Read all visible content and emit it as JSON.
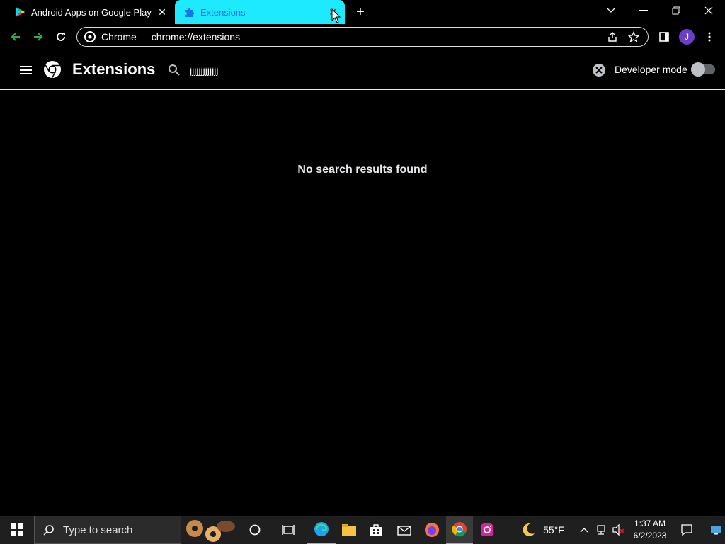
{
  "tabs": [
    {
      "title": "Android Apps on Google Play",
      "icon": "google-play-icon"
    },
    {
      "title": "Extensions",
      "icon": "puzzle-icon",
      "active": true
    }
  ],
  "toolbar": {
    "chip": "Chrome",
    "url": "chrome://extensions",
    "avatar_letter": "J"
  },
  "extensions": {
    "title": "Extensions",
    "search_value": "jjjjjjjjjjjjj",
    "developer_mode_label": "Developer mode",
    "developer_mode_on": false,
    "empty_message": "No search results found"
  },
  "taskbar": {
    "search_placeholder": "Type to search",
    "weather": "55°F",
    "time": "1:37 AM",
    "date": "6/2/2023"
  },
  "colors": {
    "active_tab": "#1de9ff",
    "accent_green": "#34a853",
    "avatar": "#6a3fc6"
  }
}
